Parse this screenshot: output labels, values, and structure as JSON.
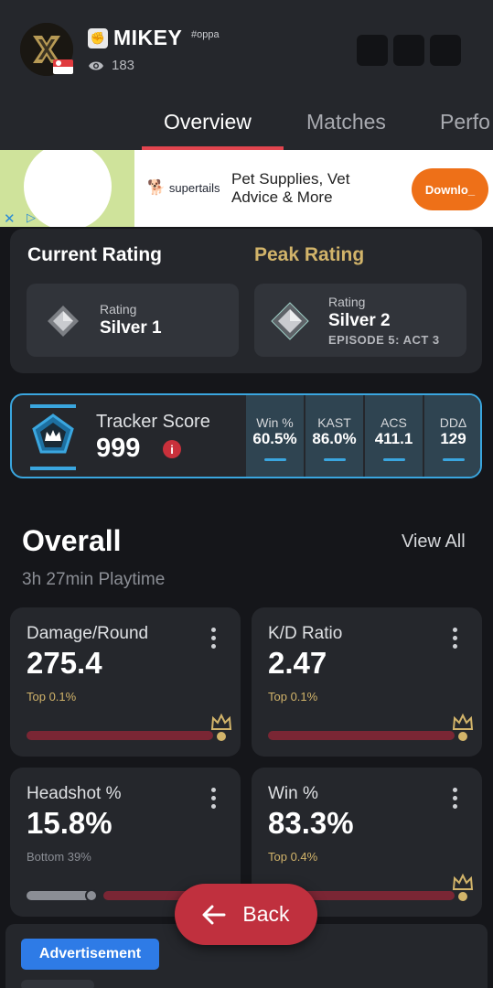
{
  "header": {
    "player_name": "MIKEY",
    "player_tag": "#oppa",
    "views": "183",
    "country": "Singapore"
  },
  "tabs": [
    {
      "label": "Overview",
      "active": true
    },
    {
      "label": "Matches",
      "active": false
    },
    {
      "label": "Perfo",
      "active": false
    }
  ],
  "ad_banner": {
    "brand": "supertails",
    "text": "Pet Supplies, Vet Advice & More",
    "cta": "Downlo_"
  },
  "rating": {
    "current_title": "Current Rating",
    "peak_title": "Peak Rating",
    "current": {
      "label": "Rating",
      "rank": "Silver 1"
    },
    "peak": {
      "label": "Rating",
      "rank": "Silver 2",
      "episode": "EPISODE 5: ACT 3"
    }
  },
  "tracker": {
    "label": "Tracker Score",
    "score": "999",
    "stats": [
      {
        "label": "Win %",
        "value": "60.5%"
      },
      {
        "label": "KAST",
        "value": "86.0%"
      },
      {
        "label": "ACS",
        "value": "411.1"
      },
      {
        "label": "DDΔ",
        "value": "129"
      }
    ]
  },
  "overall": {
    "title": "Overall",
    "view_all": "View All",
    "playtime": "3h 27min Playtime",
    "stats": [
      {
        "name": "Damage/Round",
        "value": "275.4",
        "percentile": "Top 0.1%"
      },
      {
        "name": "K/D Ratio",
        "value": "2.47",
        "percentile": "Top 0.1%"
      },
      {
        "name": "Headshot %",
        "value": "15.8%",
        "percentile": "Bottom 39%"
      },
      {
        "name": "Win %",
        "value": "83.3%",
        "percentile": "Top 0.4%"
      }
    ]
  },
  "back_button": {
    "label": "Back"
  },
  "advertisement_badge": "Advertisement",
  "colors": {
    "accent_red": "#c0303e",
    "tracker_blue": "#3aa6df",
    "peak_gold": "#d2b46a",
    "card_bg": "#25272c"
  }
}
